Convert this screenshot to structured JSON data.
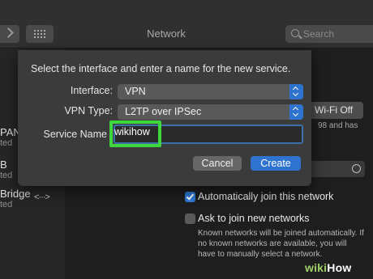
{
  "toolbar": {
    "title": "Network",
    "search_placeholder": "Search"
  },
  "sidebar": {
    "items": [
      {
        "name": "PAN",
        "status": "ted"
      },
      {
        "name": "B",
        "status": "ted"
      },
      {
        "name": "Bridge",
        "status": "ted"
      }
    ]
  },
  "background": {
    "wifi_button": "Wi-Fi Off",
    "wifi_status_1": "98 and has",
    "wifi_status_2": "",
    "auto_join_label": "Automatically join this network",
    "auto_join_checked": true,
    "ask_join_label": "Ask to join new networks",
    "ask_join_checked": false,
    "ask_join_note": "Known networks will be joined automatically. If no known networks are available, you will have to manually select a network."
  },
  "sheet": {
    "message": "Select the interface and enter a name for the new service.",
    "interface_label": "Interface:",
    "interface_value": "VPN",
    "vpn_type_label": "VPN Type:",
    "vpn_type_value": "L2TP over IPSec",
    "service_name_label": "Service Name",
    "service_name_value": "wikihow",
    "cancel_label": "Cancel",
    "create_label": "Create",
    "accent_color": "#2f73d1",
    "highlight_color": "#3ed83e"
  },
  "watermark": {
    "prefix": "wiki",
    "suffix": "How"
  }
}
